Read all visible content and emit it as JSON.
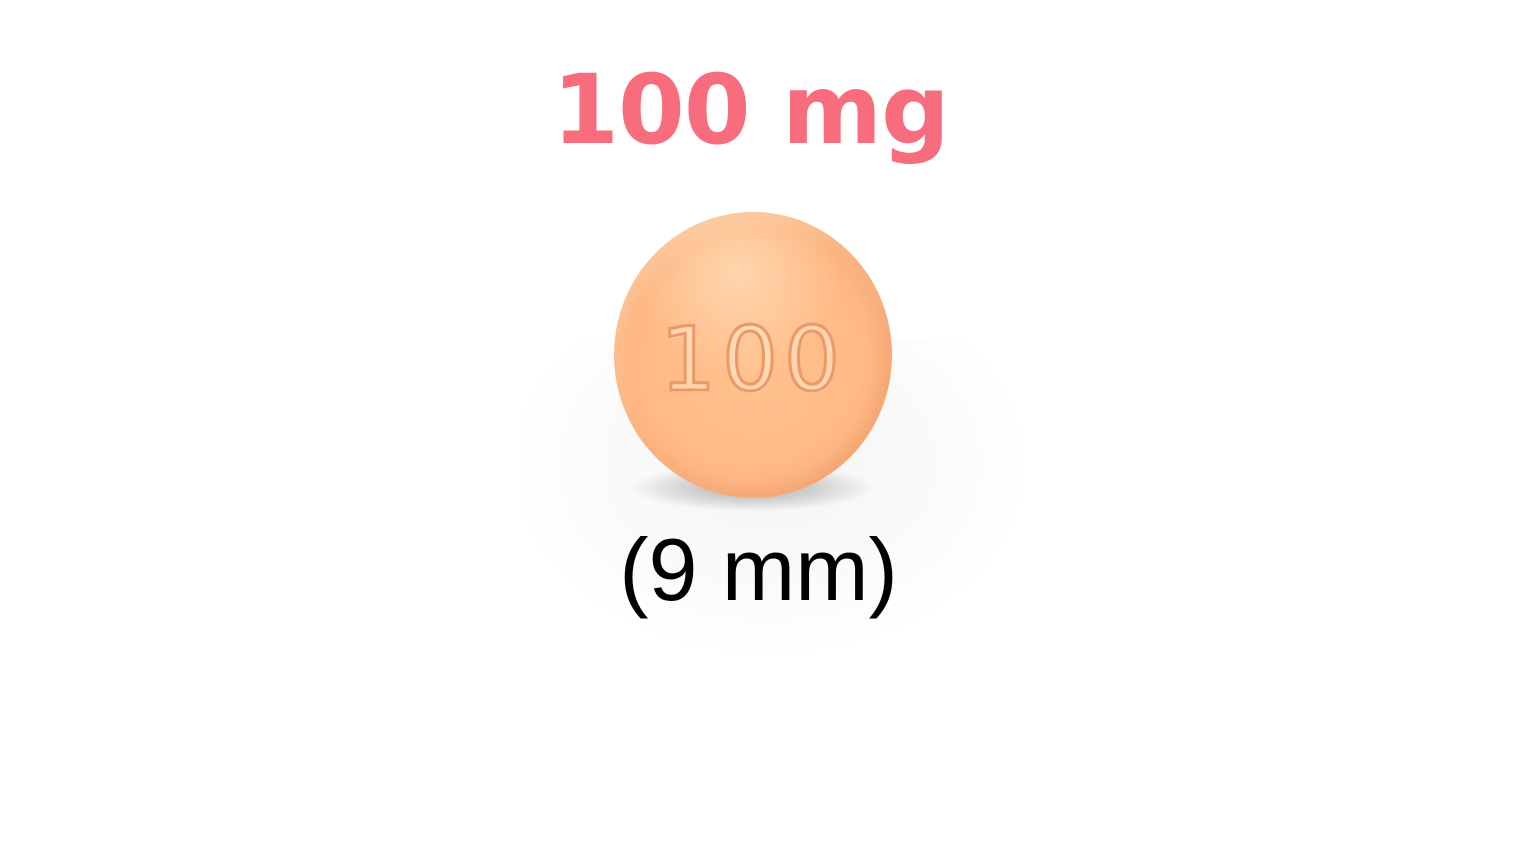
{
  "strength": {
    "label": "100 mg",
    "color": "#f76d7d"
  },
  "pill": {
    "imprint": "100",
    "color": "#ffb985",
    "shape": "round"
  },
  "size": {
    "label": "(9 mm)"
  }
}
